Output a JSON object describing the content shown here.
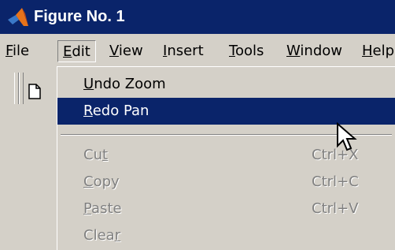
{
  "window": {
    "title": "Figure No. 1"
  },
  "menubar": {
    "items": [
      {
        "label": "File",
        "mnemonic": "F",
        "rest": "ile"
      },
      {
        "label": "Edit",
        "mnemonic": "E",
        "rest": "dit"
      },
      {
        "label": "View",
        "mnemonic": "V",
        "rest": "iew"
      },
      {
        "label": "Insert",
        "mnemonic": "I",
        "rest": "nsert"
      },
      {
        "label": "Tools",
        "mnemonic": "T",
        "rest": "ools"
      },
      {
        "label": "Window",
        "mnemonic": "W",
        "rest": "indow"
      },
      {
        "label": "Help",
        "mnemonic": "H",
        "rest": "elp"
      }
    ]
  },
  "edit_menu": {
    "undo": {
      "pre": "",
      "mnemonic": "U",
      "post": "ndo Zoom"
    },
    "redo": {
      "pre": "",
      "mnemonic": "R",
      "post": "edo Pan"
    },
    "cut": {
      "pre": "Cu",
      "mnemonic": "t",
      "post": "",
      "shortcut": "Ctrl+X"
    },
    "copy": {
      "pre": "",
      "mnemonic": "C",
      "post": "opy",
      "shortcut": "Ctrl+C"
    },
    "paste": {
      "pre": "",
      "mnemonic": "P",
      "post": "aste",
      "shortcut": "Ctrl+V"
    },
    "clear": {
      "pre": "Clea",
      "mnemonic": "r",
      "post": ""
    }
  },
  "colors": {
    "titlebar": "#0a246a",
    "menu_face": "#d4d0c8",
    "selection": "#0a246a",
    "disabled_text": "#808080"
  },
  "icons": [
    "matlab-logo-icon",
    "new-figure-icon",
    "mouse-pointer-icon"
  ]
}
